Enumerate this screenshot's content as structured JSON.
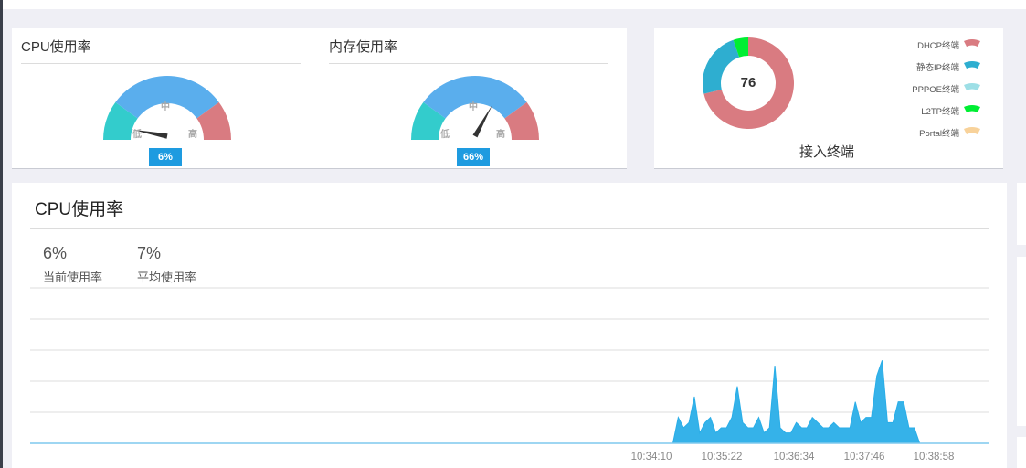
{
  "gauges": [
    {
      "title": "CPU使用率",
      "value": 6,
      "value_label": "6%",
      "low_label": "低",
      "mid_label": "中",
      "high_label": "高"
    },
    {
      "title": "内存使用率",
      "value": 66,
      "value_label": "66%",
      "low_label": "低",
      "mid_label": "中",
      "high_label": "高"
    }
  ],
  "gauge_colors": {
    "low": "#33cccc",
    "mid": "#5aaeed",
    "high": "#d97b81"
  },
  "terminals": {
    "title": "接入终端",
    "total": "76",
    "legend": [
      {
        "label": "DHCP终端",
        "color": "#d97b81",
        "value": 67
      },
      {
        "label": "静态IP终端",
        "color": "#2eaed0",
        "value": 22
      },
      {
        "label": "PPPOE终端",
        "color": "#9ddfe6",
        "value": 0
      },
      {
        "label": "L2TP终端",
        "color": "#00ee33",
        "value": 5
      },
      {
        "label": "Portal终端",
        "color": "#f8d29a",
        "value": 0
      }
    ]
  },
  "cpu_panel": {
    "title": "CPU使用率",
    "current_value": "6%",
    "current_label": "当前使用率",
    "average_value": "7%",
    "average_label": "平均使用率"
  },
  "chart_data": {
    "type": "area",
    "x": [
      0,
      1,
      2,
      3,
      4,
      5,
      6,
      7,
      8,
      9,
      10,
      11,
      12,
      13,
      14,
      15,
      16,
      17,
      18,
      19,
      20,
      21,
      22,
      23,
      24,
      25,
      26,
      27,
      28,
      29,
      30,
      31,
      32,
      33,
      34,
      35,
      36,
      37,
      38,
      39,
      40,
      41,
      42,
      43,
      44,
      45,
      46,
      47,
      48,
      49,
      50,
      51,
      52,
      53,
      54,
      55,
      56,
      57,
      58,
      59
    ],
    "values": [
      0,
      5,
      3,
      4,
      9,
      2,
      4,
      5,
      2,
      3,
      3,
      5,
      11,
      4,
      3,
      3,
      5,
      2,
      3,
      15,
      3,
      2,
      2,
      4,
      3,
      3,
      5,
      4,
      3,
      3,
      4,
      3,
      3,
      3,
      8,
      4,
      5,
      5,
      13,
      16,
      4,
      4,
      8,
      8,
      3,
      3,
      0,
      0,
      0,
      0,
      0,
      0,
      0,
      0,
      0,
      0,
      0,
      0,
      0,
      0
    ],
    "x_start_fraction": 0.67,
    "tick_labels": [
      "10:34:10",
      "10:35:22",
      "10:36:34",
      "10:37:46",
      "10:38:58"
    ],
    "ylim": [
      0,
      30
    ],
    "color": "#2aaee8",
    "grid": true
  }
}
